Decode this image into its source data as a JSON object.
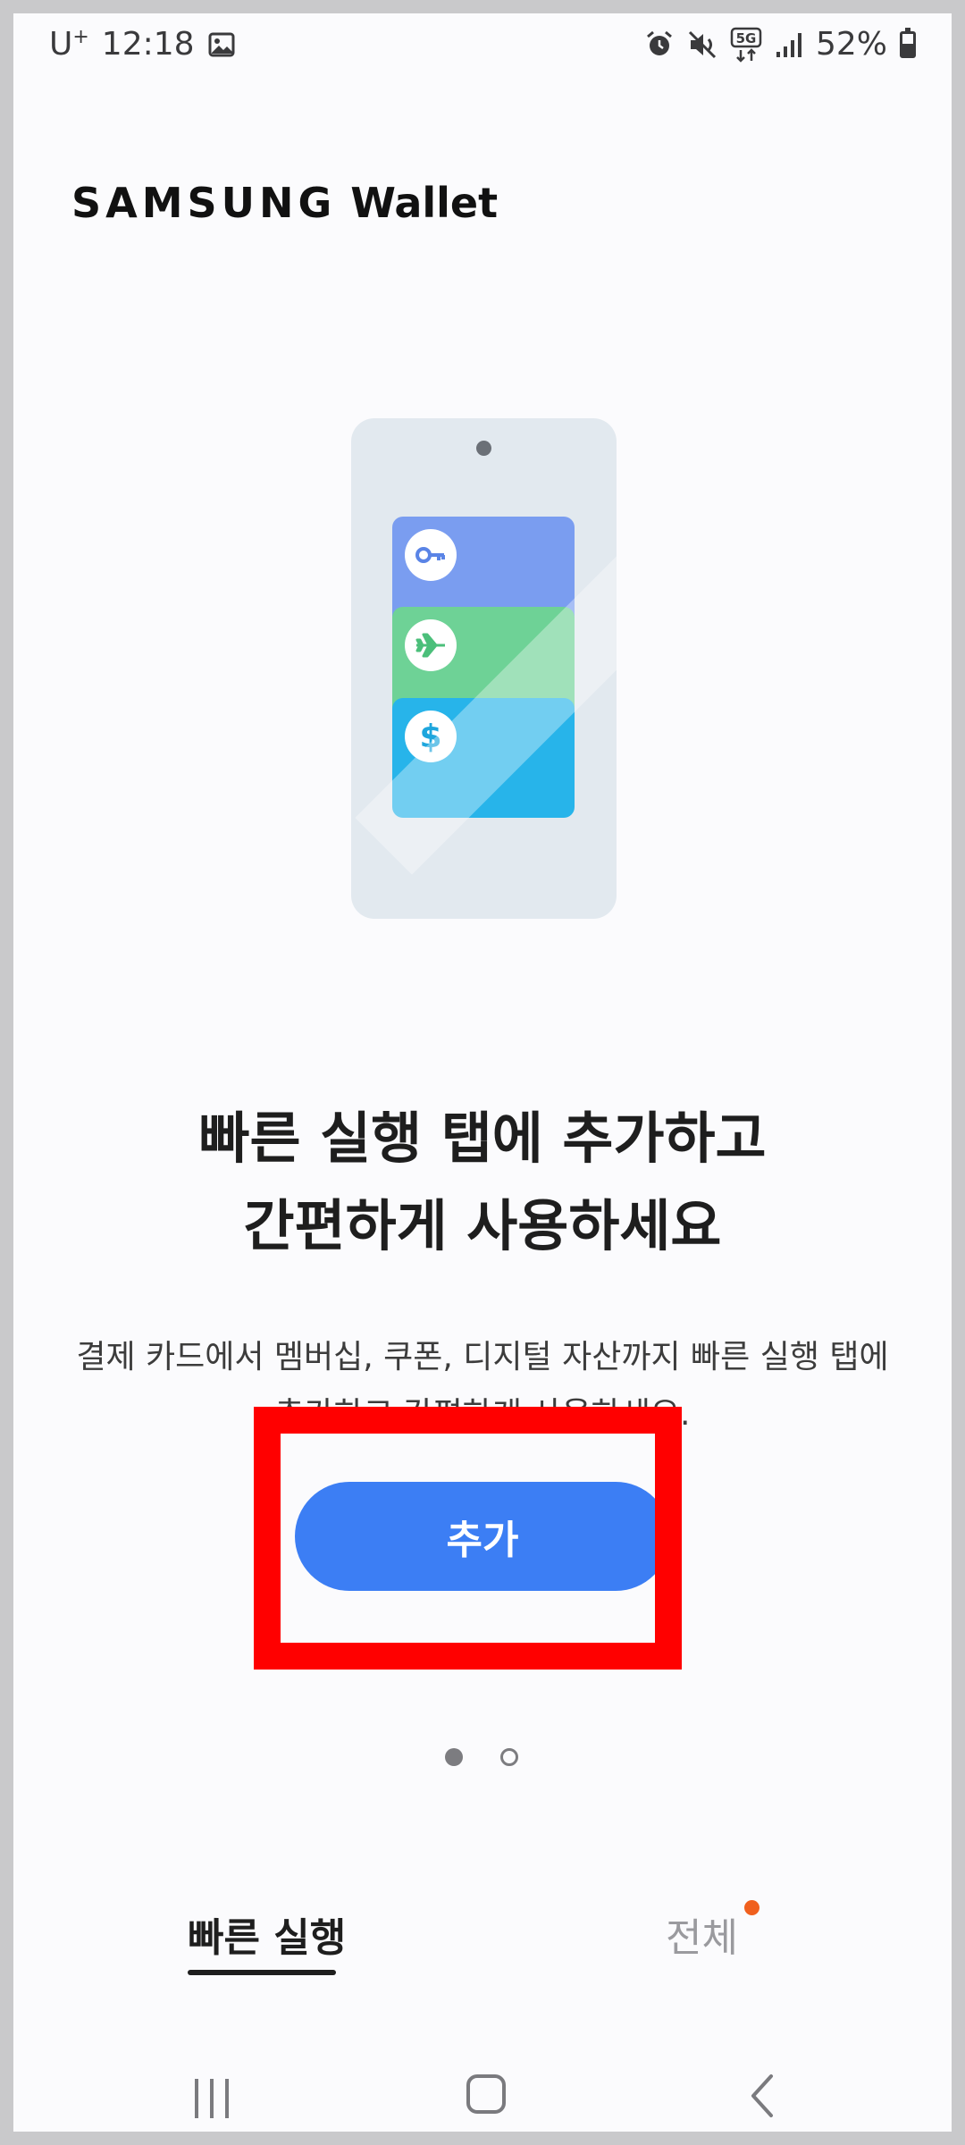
{
  "status_bar": {
    "carrier": "U",
    "carrier_sup": "+",
    "time": "12:18",
    "network": "5G",
    "battery_percent": "52%",
    "battery_level": 0.52,
    "icons": [
      "image-icon",
      "alarm-icon",
      "mute-icon",
      "5g-icon",
      "signal-icon",
      "battery-icon"
    ]
  },
  "header": {
    "brand": "SAMSUNG",
    "product": "Wallet"
  },
  "illustration": {
    "card_icons": [
      "key-icon",
      "airplane-icon",
      "dollar-icon"
    ],
    "dollar_glyph": "$",
    "colors": {
      "key_card": "#7a9df0",
      "plane_card": "#6ed296",
      "money_card": "#27b4ea"
    }
  },
  "main": {
    "headline_line1": "빠른 실행 탭에 추가하고",
    "headline_line2": "간편하게 사용하세요",
    "description": "결제 카드에서 멤버십, 쿠폰, 디지털 자산까지 빠른 실행 탭에 추가하고 간편하게 사용하세요.",
    "add_button_label": "추가",
    "accent_color": "#3c7ef4"
  },
  "pager": {
    "total": 2,
    "current": 1
  },
  "tabs": {
    "items": [
      {
        "label": "빠른 실행",
        "selected": true
      },
      {
        "label": "전체",
        "selected": false,
        "has_notification": true
      }
    ]
  },
  "nav_bar": {
    "items": [
      "recent-apps",
      "home",
      "back"
    ]
  }
}
